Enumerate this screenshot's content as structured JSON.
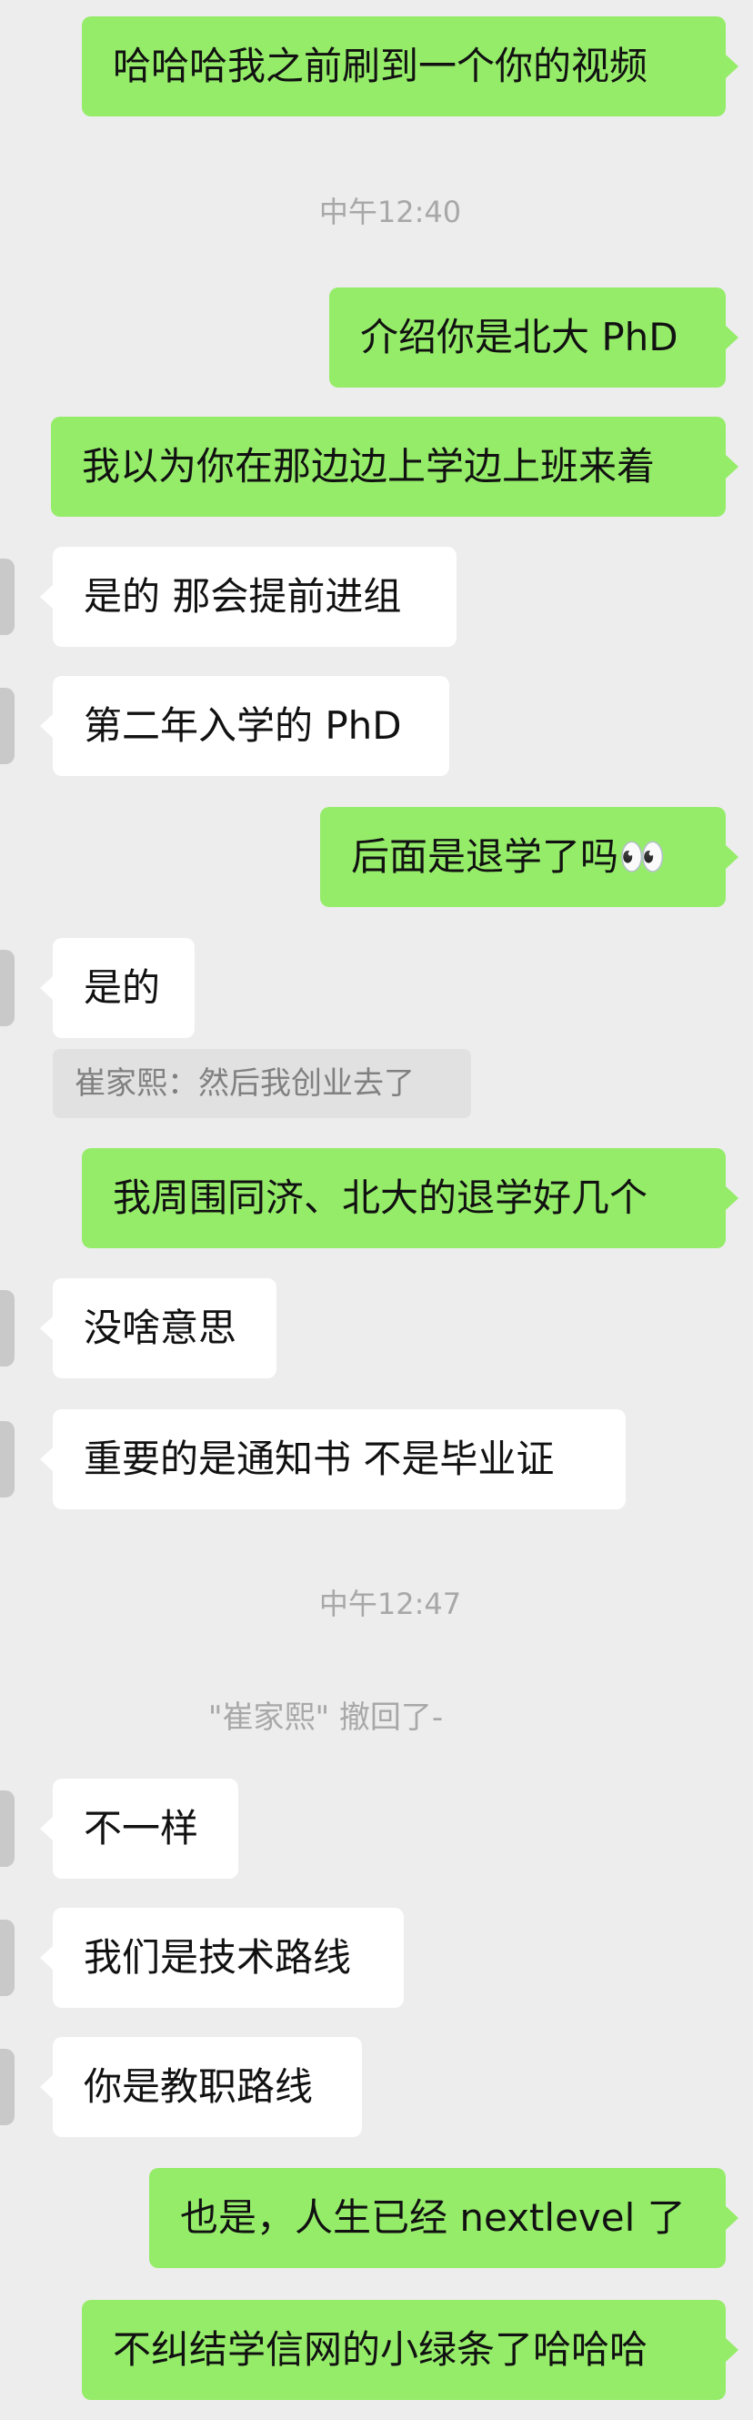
{
  "messages": [
    {
      "type": "out",
      "text": "哈哈哈我之前刷到一个你的视频"
    },
    {
      "type": "time",
      "text": "中午12:40"
    },
    {
      "type": "out",
      "text": "介绍你是北大 PhD"
    },
    {
      "type": "out",
      "text": "我以为你在那边边上学边上班来着"
    },
    {
      "type": "in",
      "text": "是的 那会提前进组"
    },
    {
      "type": "in",
      "text": "第二年入学的 PhD"
    },
    {
      "type": "out",
      "text": "后面是退学了吗👀"
    },
    {
      "type": "in",
      "text": "是的"
    },
    {
      "type": "quote",
      "text": "崔家熙：然后我创业去了"
    },
    {
      "type": "out",
      "text": "我周围同济、北大的退学好几个"
    },
    {
      "type": "in",
      "text": "没啥意思"
    },
    {
      "type": "in",
      "text": "重要的是通知书 不是毕业证"
    },
    {
      "type": "time",
      "text": "中午12:47"
    },
    {
      "type": "recall",
      "text": "\"崔家熙\" 撤回了-"
    },
    {
      "type": "in",
      "text": "不一样"
    },
    {
      "type": "in",
      "text": "我们是技术路线"
    },
    {
      "type": "in",
      "text": "你是教职路线"
    },
    {
      "type": "out",
      "text": "也是，人生已经 nextlevel 了"
    },
    {
      "type": "out",
      "text": "不纠结学信网的小绿条了哈哈哈"
    }
  ],
  "colors": {
    "background": "#ededed",
    "outgoing_bubble": "#95ec69",
    "incoming_bubble": "#ffffff",
    "system_text": "#a8a8a8"
  }
}
